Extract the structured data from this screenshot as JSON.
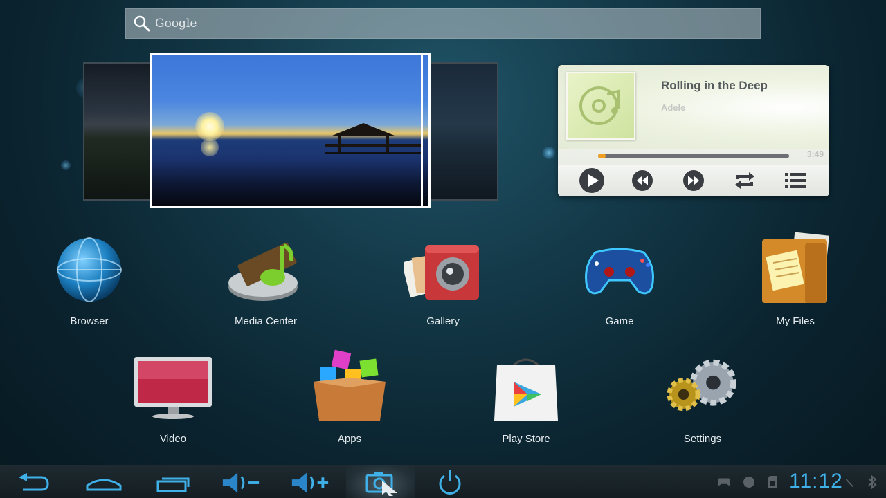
{
  "search": {
    "placeholder": "Google"
  },
  "music": {
    "title": "Rolling in the Deep",
    "artist": "Adele",
    "duration": "3:49",
    "progress": 0.04
  },
  "apps_row1": [
    {
      "label": "Browser",
      "icon": "globe-icon"
    },
    {
      "label": "Media Center",
      "icon": "media-center-icon"
    },
    {
      "label": "Gallery",
      "icon": "camera-icon"
    },
    {
      "label": "Game",
      "icon": "gamepad-icon"
    },
    {
      "label": "My Files",
      "icon": "folder-icon"
    }
  ],
  "apps_row2": [
    {
      "label": "Video",
      "icon": "tv-icon"
    },
    {
      "label": "Apps",
      "icon": "apps-box-icon"
    },
    {
      "label": "Play Store",
      "icon": "play-store-icon"
    },
    {
      "label": "Settings",
      "icon": "gears-icon"
    }
  ],
  "statusbar": {
    "clock": "11:12"
  },
  "colors": {
    "accent": "#3fb0e8",
    "progress": "#f0a020"
  }
}
